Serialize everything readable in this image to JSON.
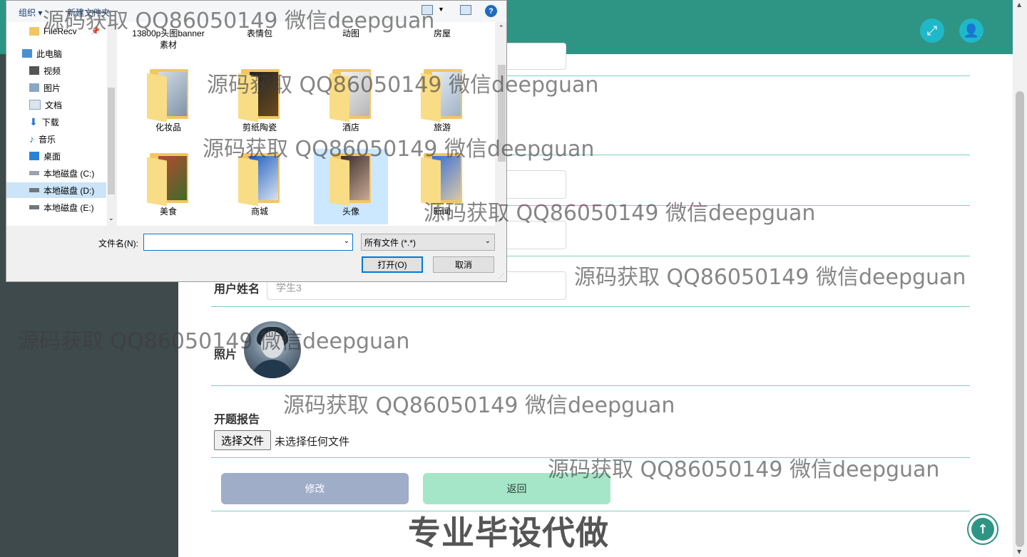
{
  "topbar": {
    "color": "#2e9585",
    "fullscreen_icon": "expand-icon",
    "user_icon": "user-icon"
  },
  "form": {
    "username_label": "用户姓名",
    "username_value": "学生3",
    "photo_label": "照片",
    "report_label": "开题报告",
    "file_button": "选择文件",
    "file_none": "未选择任何文件",
    "edit_button": "修改",
    "back_button": "返回"
  },
  "promo_text": "专业毕设代做",
  "dialog": {
    "toolbar": {
      "organize": "组织 ▾",
      "new_folder": "新建文件夹"
    },
    "nav_items": [
      {
        "label": "FileRecv",
        "icon": "folder-icon"
      },
      {
        "label": "此电脑",
        "icon": "computer-icon"
      },
      {
        "label": "视频",
        "icon": "video-icon"
      },
      {
        "label": "图片",
        "icon": "pictures-icon"
      },
      {
        "label": "文档",
        "icon": "documents-icon"
      },
      {
        "label": "下载",
        "icon": "download-icon"
      },
      {
        "label": "音乐",
        "icon": "music-icon"
      },
      {
        "label": "桌面",
        "icon": "desktop-icon"
      },
      {
        "label": "本地磁盘 (C:)",
        "icon": "drive-icon"
      },
      {
        "label": "本地磁盘 (D:)",
        "icon": "drive-icon"
      },
      {
        "label": "本地磁盘 (E:)",
        "icon": "drive-icon"
      }
    ],
    "files_row0": [
      "13800p头图banner素材",
      "表情包",
      "动图",
      "房屋"
    ],
    "files_row1": [
      "化妆品",
      "剪纸陶瓷",
      "酒店",
      "旅游"
    ],
    "files_row2": [
      "美食",
      "商城",
      "头像",
      "新闻"
    ],
    "filename_label": "文件名(N):",
    "filename_value": "",
    "filetype_value": "所有文件 (*.*)",
    "open_button": "打开(O)",
    "cancel_button": "取消"
  },
  "watermarks": [
    "源码获取 QQ86050149 微信deepguan",
    "源码获取 QQ86050149 微信deepguan",
    "源码获取 QQ86050149 微信deepguan",
    "源码获取 QQ86050149 微信deepguan",
    "源码获取 QQ86050149 微信deepguan",
    "源码获取 QQ86050149 微信deepguan",
    "源码获取 QQ86050149 微信deepguan",
    "源码获取 QQ86050149 微信deepguan"
  ]
}
